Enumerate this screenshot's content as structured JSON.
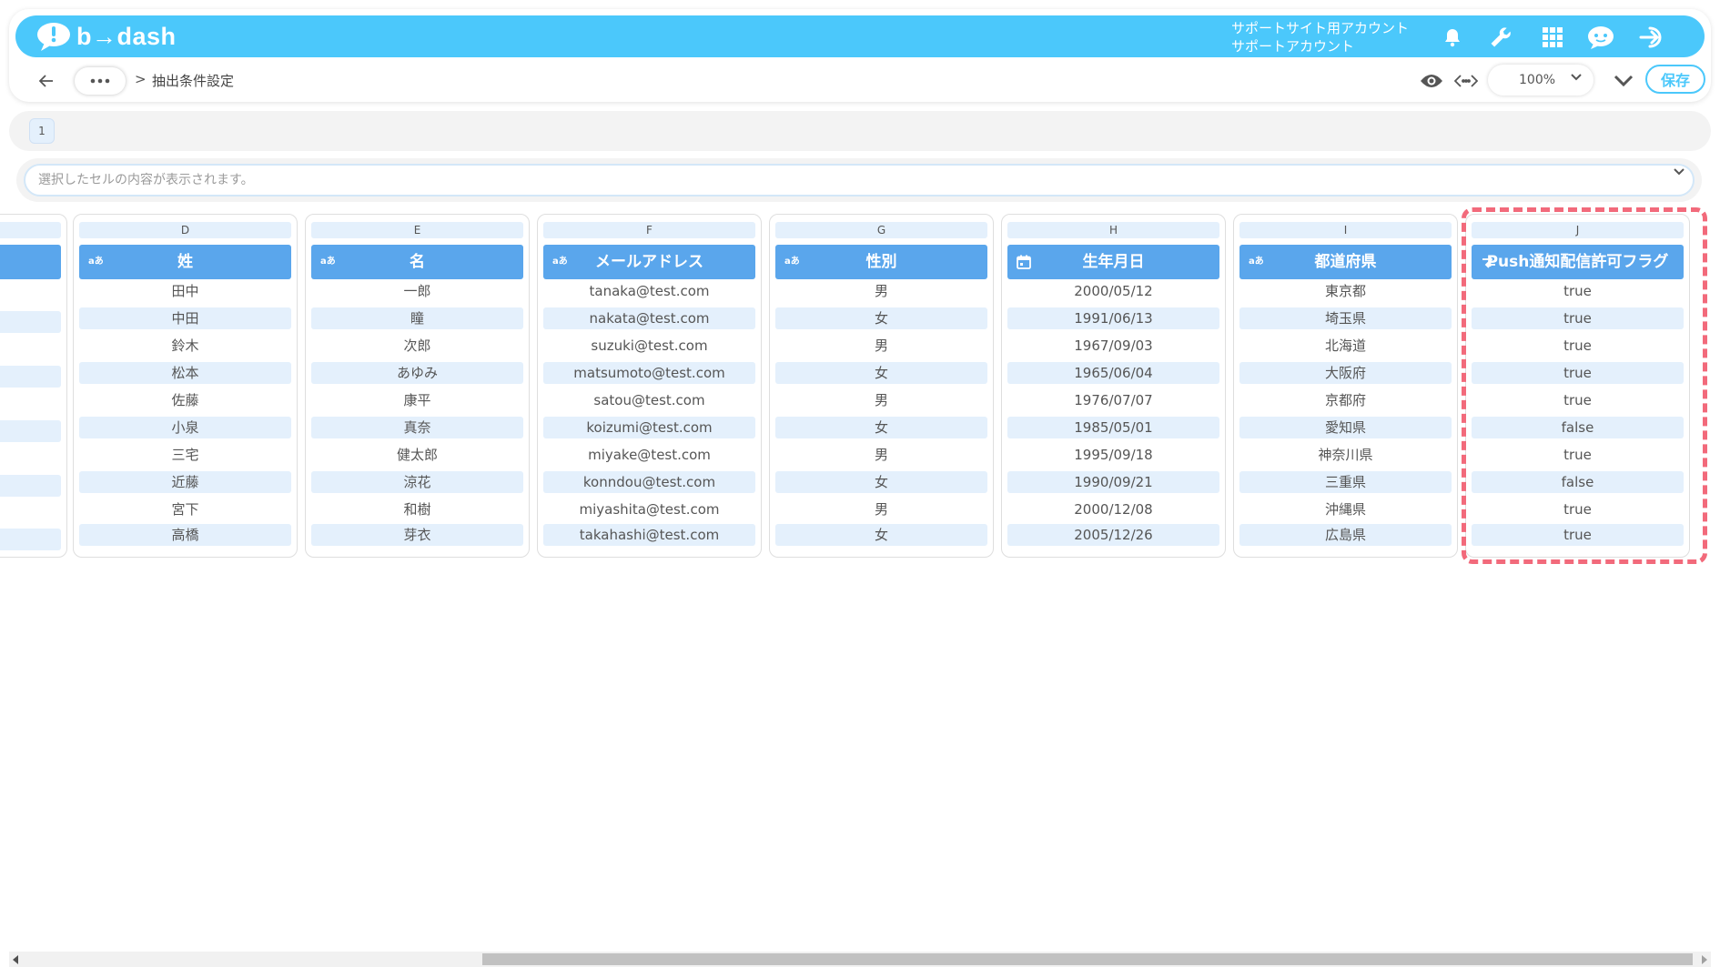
{
  "header": {
    "logo_text": "b→dash",
    "account_line1": "サポートサイト用アカウント",
    "account_line2": "サポートアカウント",
    "icons": [
      "bell-icon",
      "wrench-icon",
      "apps-grid-icon",
      "support-chat-icon",
      "logout-icon"
    ],
    "color": "#4bc8fb"
  },
  "toolbar": {
    "breadcrumb_sep": ">",
    "title": "抽出条件設定",
    "zoom": "100%",
    "save_label": "保存"
  },
  "pages": [
    "1"
  ],
  "cell_display": {
    "placeholder": "選択したセルの内容が表示されます。"
  },
  "type_badges": {
    "text": "aあ"
  },
  "columns": [
    {
      "letter": "D",
      "title": "姓",
      "type": "text",
      "values": [
        "田中",
        "中田",
        "鈴木",
        "松本",
        "佐藤",
        "小泉",
        "三宅",
        "近藤",
        "宮下",
        "高橋"
      ]
    },
    {
      "letter": "E",
      "title": "名",
      "type": "text",
      "values": [
        "一郎",
        "瞳",
        "次郎",
        "あゆみ",
        "康平",
        "真奈",
        "健太郎",
        "涼花",
        "和樹",
        "芽衣"
      ]
    },
    {
      "letter": "F",
      "title": "メールアドレス",
      "type": "text",
      "values": [
        "tanaka@test.com",
        "nakata@test.com",
        "suzuki@test.com",
        "matsumoto@test.com",
        "satou@test.com",
        "koizumi@test.com",
        "miyake@test.com",
        "konndou@test.com",
        "miyashita@test.com",
        "takahashi@test.com"
      ]
    },
    {
      "letter": "G",
      "title": "性別",
      "type": "text",
      "values": [
        "男",
        "女",
        "男",
        "女",
        "男",
        "女",
        "男",
        "女",
        "男",
        "女"
      ]
    },
    {
      "letter": "H",
      "title": "生年月日",
      "type": "date",
      "values": [
        "2000/05/12",
        "1991/06/13",
        "1967/09/03",
        "1965/06/04",
        "1976/07/07",
        "1985/05/01",
        "1995/09/18",
        "1990/09/21",
        "2000/12/08",
        "2005/12/26"
      ]
    },
    {
      "letter": "I",
      "title": "都道府県",
      "type": "text",
      "values": [
        "東京都",
        "埼玉県",
        "北海道",
        "大阪府",
        "京都府",
        "愛知県",
        "神奈川県",
        "三重県",
        "沖縄県",
        "広島県"
      ]
    },
    {
      "letter": "J",
      "title": "Push通知配信許可フラグ",
      "type": "boolean",
      "values": [
        "true",
        "true",
        "true",
        "true",
        "true",
        "false",
        "true",
        "false",
        "true",
        "true"
      ]
    }
  ],
  "colors": {
    "header_blue": "#4bc8fb",
    "column_header": "#5aa6ec",
    "row_alt": "#e4f0fc",
    "highlight": "#f26a7b"
  }
}
